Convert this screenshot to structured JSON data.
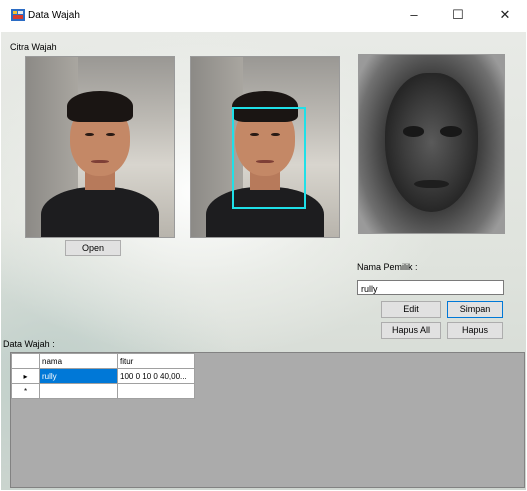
{
  "window": {
    "title": "Data Wajah",
    "minimize": "–",
    "maximize": "☐",
    "close": "✕"
  },
  "labels": {
    "citra_wajah": "Citra Wajah",
    "nama_pemilik": "Nama Pemilik :",
    "data_wajah": "Data Wajah :"
  },
  "buttons": {
    "open": "Open",
    "edit": "Edit",
    "simpan": "Simpan",
    "hapus_all": "Hapus All",
    "hapus": "Hapus"
  },
  "input": {
    "nama_value": "rully"
  },
  "grid": {
    "columns": [
      "nama",
      "fitur"
    ],
    "rows": [
      {
        "indicator": "▸",
        "nama": "rully",
        "fitur": "100 0 10 0 40,00..."
      },
      {
        "indicator": "*",
        "nama": "",
        "fitur": ""
      }
    ]
  },
  "colors": {
    "face_box": "#1fe0e8",
    "selection": "#0078d7"
  }
}
